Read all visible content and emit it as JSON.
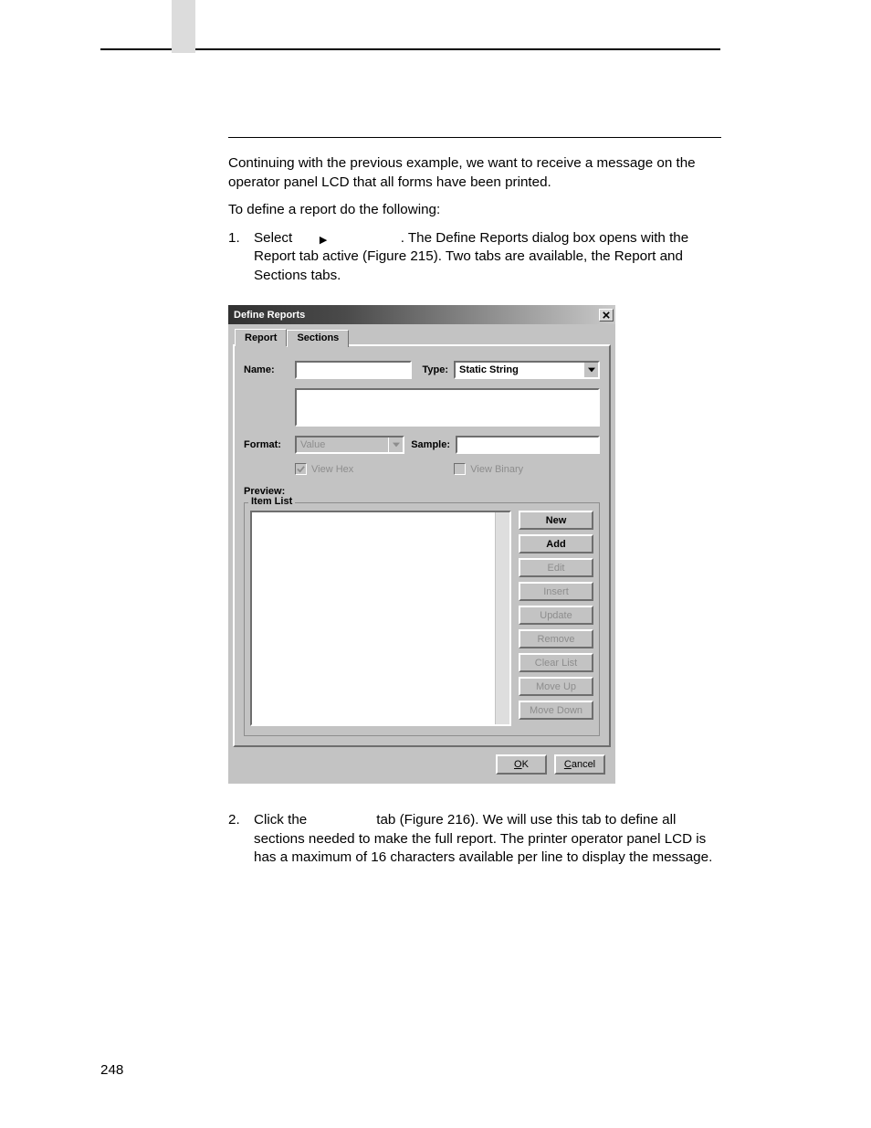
{
  "page_number": "248",
  "intro": {
    "p1": "Continuing with the previous example, we want to receive a message on the operator panel LCD that all forms have been printed.",
    "p2": "To define a report do the following:"
  },
  "step1": {
    "num": "1.",
    "lead": "Select",
    "tail": ". The Define Reports dialog box opens with the Report tab active (Figure 215). Two tabs are available, the Report and Sections tabs."
  },
  "step2": {
    "num": "2.",
    "lead": "Click the",
    "tail": "tab (Figure 216). We will use this tab to define all sections needed to make the full report. The printer operator panel LCD is has a maximum of 16 characters available per line to display the message."
  },
  "dialog": {
    "title": "Define Reports",
    "tabs": {
      "report": "Report",
      "sections": "Sections"
    },
    "labels": {
      "name": "Name:",
      "type": "Type:",
      "format": "Format:",
      "sample": "Sample:",
      "preview": "Preview:",
      "item_list": "Item List"
    },
    "fields": {
      "name_value": "",
      "type_value": "Static String",
      "format_value": "Value",
      "sample_value": "",
      "textarea_value": ""
    },
    "check": {
      "view_hex": "View Hex",
      "view_binary": "View Binary"
    },
    "buttons": {
      "new": "New",
      "add": "Add",
      "edit": "Edit",
      "insert": "Insert",
      "update": "Update",
      "remove": "Remove",
      "clear_list": "Clear List",
      "move_up": "Move Up",
      "move_down": "Move Down",
      "ok": "OK",
      "cancel": "Cancel"
    }
  }
}
